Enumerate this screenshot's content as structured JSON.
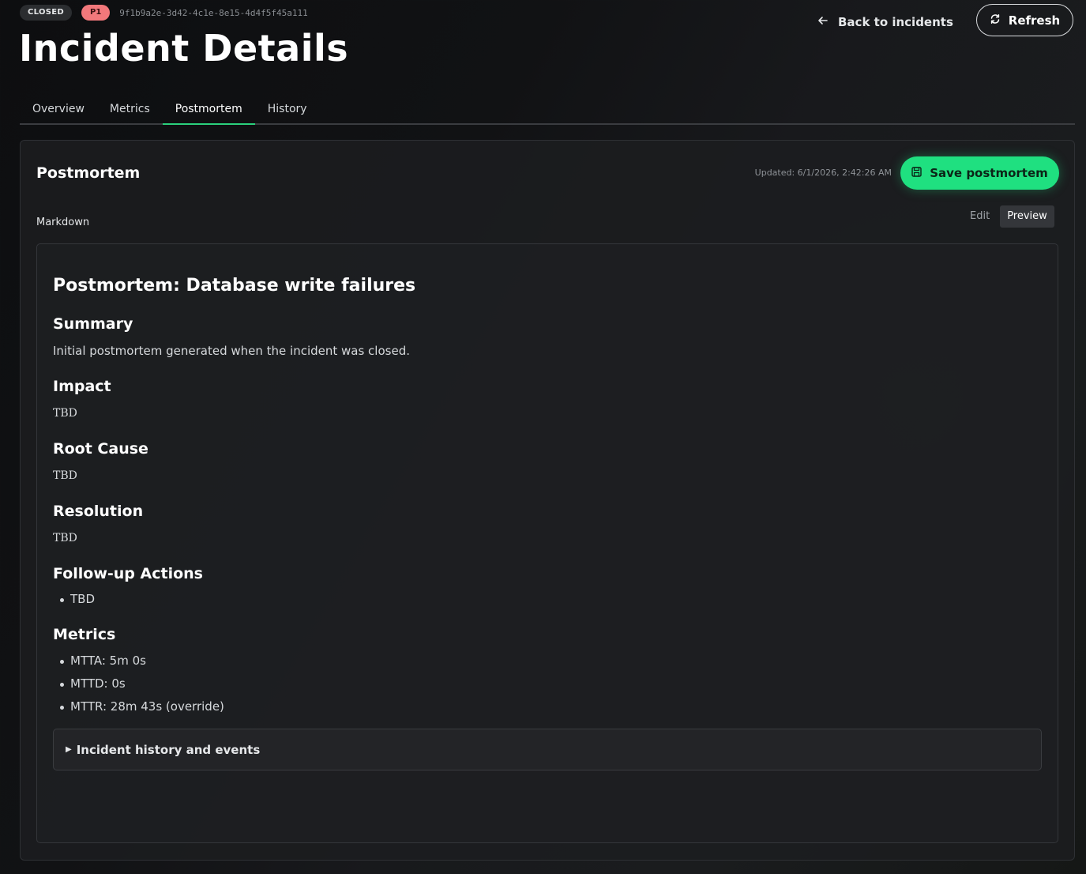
{
  "header": {
    "status_badge": "CLOSED",
    "priority_badge": "P1",
    "incident_id": "9f1b9a2e-3d42-4c1e-8e15-4d4f5f45a111",
    "title": "Incident Details",
    "back_label": "Back to incidents",
    "refresh_label": "Refresh"
  },
  "tabs": [
    {
      "label": "Overview",
      "active": false
    },
    {
      "label": "Metrics",
      "active": false
    },
    {
      "label": "Postmortem",
      "active": true
    },
    {
      "label": "History",
      "active": false
    }
  ],
  "panel": {
    "title": "Postmortem",
    "updated": "Updated: 6/1/2026, 2:42:26 AM",
    "save_label": "Save postmortem",
    "markdown_label": "Markdown",
    "mode_edit": "Edit",
    "mode_preview": "Preview",
    "active_mode": "Preview"
  },
  "document": {
    "title": "Postmortem: Database write failures",
    "summary_heading": "Summary",
    "summary_text": "Initial postmortem generated when the incident was closed.",
    "impact_heading": "Impact",
    "impact_text": "TBD",
    "root_cause_heading": "Root Cause",
    "root_cause_text": "TBD",
    "resolution_heading": "Resolution",
    "resolution_text": "TBD",
    "followup_heading": "Follow-up Actions",
    "followup_items": [
      "TBD"
    ],
    "metrics_heading": "Metrics",
    "metrics_items": [
      "MTTA: 5m 0s",
      "MTTD: 0s",
      "MTTR: 28m 43s (override)"
    ],
    "details_label": "Incident history and events"
  },
  "colors": {
    "accent": "#1fe080",
    "tab_underline": "#2bd07c",
    "priority": "#f2787b",
    "background": "#111214"
  },
  "icons": {
    "back": "arrow-left-icon",
    "refresh": "refresh-icon",
    "save": "floppy-disk-icon",
    "details": "triangle-right-icon"
  }
}
